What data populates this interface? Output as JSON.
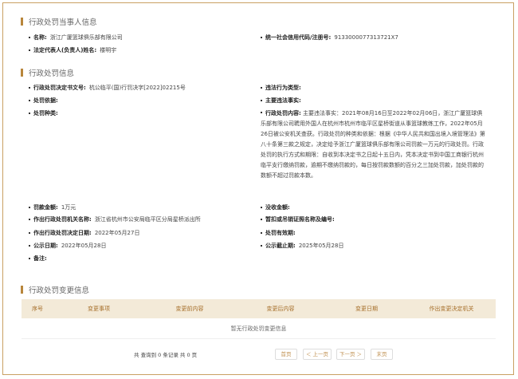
{
  "sections": {
    "party": "行政处罚当事人信息",
    "penalty": "行政处罚信息",
    "changes": "行政处罚变更信息"
  },
  "party": {
    "name_label": "名称:",
    "name_value": "浙江广厦篮球俱乐部有限公司",
    "credit_label": "统一社会信用代码/注册号:",
    "credit_value": "9133000077313721X7",
    "rep_label": "法定代表人(负责人)姓名:",
    "rep_value": "楼明宇"
  },
  "penalty": {
    "doc_no_label": "行政处罚决定书文号:",
    "doc_no_value": "杭公临平(国)行罚决字[2022]02215号",
    "violation_type_label": "违法行为类型:",
    "basis_label": "处罚依据:",
    "main_fact_label": "主要违法事实:",
    "kind_label": "处罚种类:",
    "content_label": "行政处罚内容:",
    "content_value": "主要违法事实：2021年08月16日至2022年02月06日，浙江广厦篮球俱乐部有限公司聘用外国人在杭州市杭州市临平区星桥街道从事篮球教练工作，2022年05月26日被公安机关查获。行政处罚的种类和依据：根据《中华人民共和国出境入境管理法》第八十条第三款之规定，决定给予浙江广厦篮球俱乐部有限公司罚款一万元的行政处罚。行政处罚的执行方式和期限：自收到本决定书之日起十五日内，凭本决定书到中国工商银行杭州临平支行缴纳罚款，逾期不缴纳罚款的，每日按罚款数额的百分之三加处罚款，加处罚款的数额不超过罚款本数。",
    "fine_label": "罚款金额:",
    "fine_value": "1万元",
    "confiscate_label": "没收金额:",
    "org_label": "作出行政处罚机关名称:",
    "org_value": "浙江省杭州市公安局临平区分局星桥派出所",
    "license_label": "暂扣或吊销证照名称及编号:",
    "date_label": "作出行政处罚决定日期:",
    "date_value": "2022年05月27日",
    "valid_label": "处罚有效期:",
    "pub_label": "公示日期:",
    "pub_value": "2022年05月28日",
    "pub_end_label": "公示截止期:",
    "pub_end_value": "2025年05月28日",
    "remark_label": "备注:"
  },
  "changes": {
    "headers": [
      "序号",
      "变更事项",
      "变更前内容",
      "变更后内容",
      "变更日期",
      "作出变更决定机关"
    ],
    "empty": "暂无行政处罚变更信息"
  },
  "pager": {
    "info": "共 查询到 0 条记录 共 0 页",
    "first": "首页",
    "prev": "＜ 上一页",
    "next": "下一页 ＞",
    "last": "末页"
  },
  "colors": {
    "accent": "#b8863b",
    "header_bg": "#f3ead8",
    "border": "#c9a063"
  }
}
